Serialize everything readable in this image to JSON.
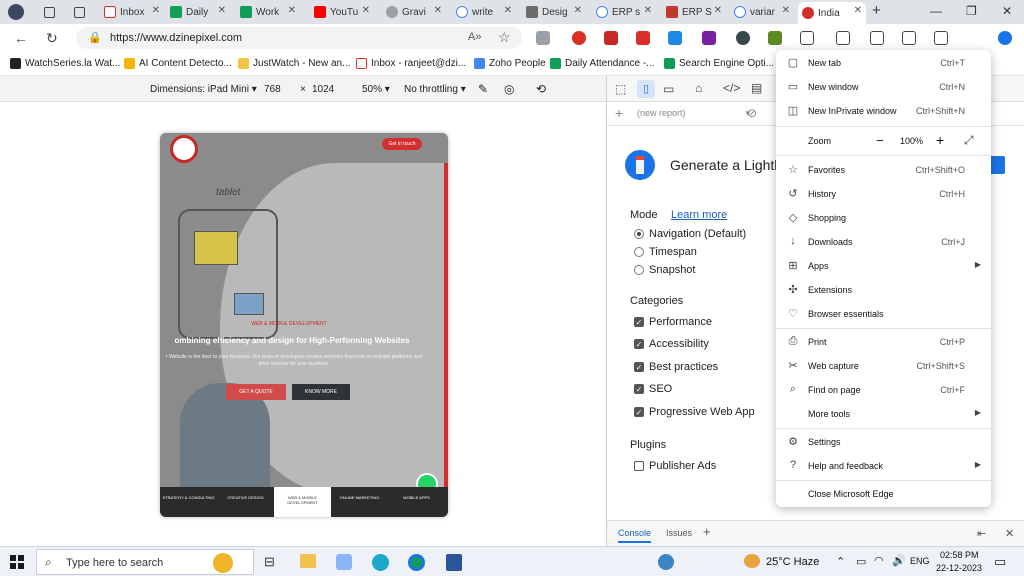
{
  "tabs": [
    {
      "label": "",
      "color": "#3a3a3a"
    },
    {
      "label": "",
      "color": "#555555"
    },
    {
      "label": "",
      "color": "#555555"
    },
    {
      "label": "Inbox",
      "color": "#d93025"
    },
    {
      "label": "Daily",
      "color": "#0f9d58"
    },
    {
      "label": "Work",
      "color": "#0f9d58"
    },
    {
      "label": "YouTu",
      "color": "#ff0000"
    },
    {
      "label": "Gravi",
      "color": "#4285f4"
    },
    {
      "label": "write",
      "color": "#4285f4"
    },
    {
      "label": "Desig",
      "color": "#6b6b6b"
    },
    {
      "label": "ERP s",
      "color": "#4285f4"
    },
    {
      "label": "ERP S",
      "color": "#c0392b"
    },
    {
      "label": "variar",
      "color": "#4285f4"
    },
    {
      "label": "India",
      "color": "#d32f2f"
    }
  ],
  "address": {
    "url": "https://www.dzinepixel.com"
  },
  "favorites": [
    {
      "label": "WatchSeries.la  Wat...",
      "color": "#222222"
    },
    {
      "label": "AI Content Detecto...",
      "color": "#f4b400"
    },
    {
      "label": "JustWatch - New an...",
      "color": "#f4c542"
    },
    {
      "label": "Inbox - ranjeet@dzi...",
      "color": "#d93025"
    },
    {
      "label": "Zoho People",
      "color": "#4285f4"
    },
    {
      "label": "Daily Attendance -...",
      "color": "#0f9d58"
    },
    {
      "label": "Search Engine Opti...",
      "color": "#0f9d58"
    }
  ],
  "device_toolbar": {
    "dimensions": "Dimensions: iPad Mini",
    "width": "768",
    "times": "×",
    "height": "1024",
    "zoom": "50%",
    "throttle": "No throttling"
  },
  "site": {
    "cta": "Get in touch",
    "hero_kicker": "WEB & MOBILE DEVELOPMENT",
    "hero_title": "ombining efficiency and design for High-Performing Websites",
    "hero_text": "r Website is the door to your business. Our team of developers creates websites that work on multiple platforms and drive revenue for your business.",
    "btn_quote": "GET A QUOTE",
    "btn_more": "KNOW MORE",
    "sketch_word": "tablet",
    "bottom_nav": [
      "STRATEGY & CONSULTING",
      "CREATIVE DESIGN",
      "WEB & MOBILE DEVELOPMENT",
      "ONLINE MARKETING",
      "MOBILE APPS"
    ]
  },
  "lighthouse": {
    "new_report": "(new report)",
    "title": "Generate a Lighth",
    "mode_label": "Mode",
    "learn_more": "Learn more",
    "modes": [
      "Navigation (Default)",
      "Timespan",
      "Snapshot"
    ],
    "categories_label": "Categories",
    "categories": [
      "Performance",
      "Accessibility",
      "Best practices",
      "SEO",
      "Progressive Web App"
    ],
    "plugins_label": "Plugins",
    "plugins": [
      "Publisher Ads"
    ],
    "console_tab": "Console",
    "issues_tab": "Issues"
  },
  "menu": {
    "items": [
      {
        "label": "New tab",
        "shortcut": "Ctrl+T",
        "icon": "new-tab-icon"
      },
      {
        "label": "New window",
        "shortcut": "Ctrl+N",
        "icon": "new-window-icon"
      },
      {
        "label": "New InPrivate window",
        "shortcut": "Ctrl+Shift+N",
        "icon": "inprivate-icon"
      },
      {
        "label": "Favorites",
        "shortcut": "Ctrl+Shift+O",
        "icon": "favorites-icon"
      },
      {
        "label": "History",
        "shortcut": "Ctrl+H",
        "icon": "history-icon"
      },
      {
        "label": "Shopping",
        "shortcut": "",
        "icon": "shopping-icon"
      },
      {
        "label": "Downloads",
        "shortcut": "Ctrl+J",
        "icon": "downloads-icon"
      },
      {
        "label": "Apps",
        "shortcut": "",
        "icon": "apps-icon"
      },
      {
        "label": "Extensions",
        "shortcut": "",
        "icon": "extensions-icon"
      },
      {
        "label": "Browser essentials",
        "shortcut": "",
        "icon": "heart-icon"
      },
      {
        "label": "Print",
        "shortcut": "Ctrl+P",
        "icon": "print-icon"
      },
      {
        "label": "Web capture",
        "shortcut": "Ctrl+Shift+S",
        "icon": "web-capture-icon"
      },
      {
        "label": "Find on page",
        "shortcut": "Ctrl+F",
        "icon": "find-icon"
      },
      {
        "label": "More tools",
        "shortcut": "",
        "icon": ""
      },
      {
        "label": "Settings",
        "shortcut": "",
        "icon": "gear-icon"
      },
      {
        "label": "Help and feedback",
        "shortcut": "",
        "icon": "help-icon"
      },
      {
        "label": "Close Microsoft Edge",
        "shortcut": "",
        "icon": ""
      }
    ],
    "zoom_label": "Zoom",
    "zoom_minus": "−",
    "zoom_value": "100%",
    "zoom_plus": "+"
  },
  "taskbar": {
    "search_placeholder": "Type here to search",
    "weather": "25°C  Haze",
    "lang": "ENG",
    "time": "02:58 PM",
    "date": "22-12-2023"
  }
}
